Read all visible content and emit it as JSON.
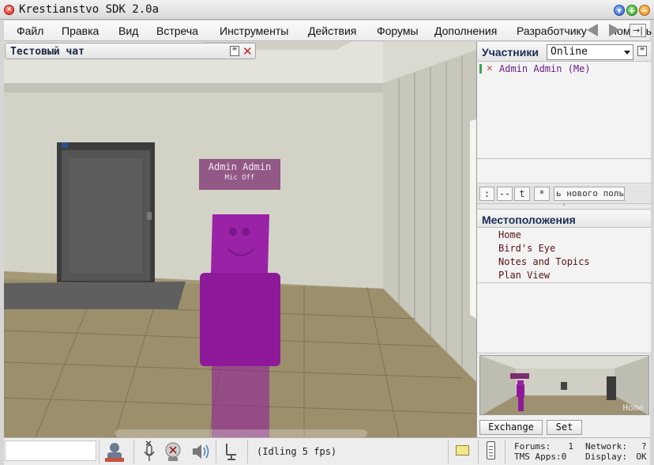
{
  "window": {
    "title": "Krestianstvo SDK 2.0a"
  },
  "menu": {
    "items": [
      "Файл",
      "Правка",
      "Вид",
      "Встреча",
      "Инструменты",
      "Действия",
      "Форумы",
      "Дополнения",
      "Разработчику",
      "Помощь"
    ],
    "icons": [
      "back-arrow-icon",
      "forward-arrow-icon",
      "exit-icon"
    ]
  },
  "chat_panel": {
    "title": "Тестовый чат"
  },
  "avatar_tag": {
    "name": "Admin Admin",
    "status": "Mic Off"
  },
  "participants": {
    "heading": "Участники",
    "status_value": "Online",
    "items": [
      {
        "name": "Admin Admin  (Me)"
      }
    ],
    "tool_buttons": [
      ":",
      "--",
      "t",
      "*"
    ],
    "invite_placeholder": "ь нового поль"
  },
  "locations": {
    "heading": "Местоположения",
    "items": [
      "Home",
      "Bird's Eye",
      "Notes and Topics",
      "Plan View"
    ]
  },
  "minimap": {
    "label": "Home"
  },
  "right_buttons": {
    "exchange": "Exchange",
    "set": "Set"
  },
  "statusbar": {
    "idle_text": "(Idling 5 fps)",
    "forums_label": "Forums:",
    "forums_value": "1",
    "tms_apps_label": "TMS Apps:",
    "tms_apps_value": "0",
    "network_label": "Network:",
    "network_value": "?",
    "display_label": "Display:",
    "display_value": "OK"
  },
  "colors": {
    "avatar": "#8e1a9a",
    "title_text": "#1a2c55",
    "participant_text": "#6b1f87",
    "location_text": "#5b1212"
  }
}
